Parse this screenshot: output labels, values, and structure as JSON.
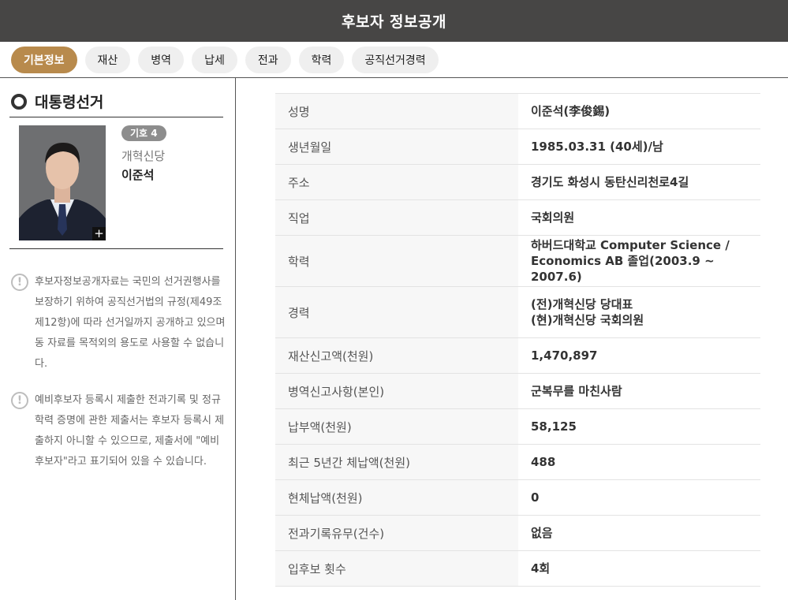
{
  "header": {
    "title": "후보자 정보공개"
  },
  "tabs": [
    {
      "label": "기본정보"
    },
    {
      "label": "재산"
    },
    {
      "label": "병역"
    },
    {
      "label": "납세"
    },
    {
      "label": "전과"
    },
    {
      "label": "학력"
    },
    {
      "label": "공직선거경력"
    }
  ],
  "sidebar": {
    "election_title": "대통령선거",
    "candidate": {
      "number_badge": "기호 4",
      "party": "개혁신당",
      "name": "이준석"
    },
    "notices": [
      "후보자정보공개자료는 국민의 선거권행사를 보장하기 위하여 공직선거법의 규정(제49조 제12항)에 따라 선거일까지 공개하고 있으며 동 자료를 목적외의 용도로 사용할 수 없습니다.",
      "예비후보자 등록시 제출한 전과기록 및 정규학력 증명에 관한 제출서는 후보자 등록시 제출하지 아니할 수 있으므로, 제출서에 \"예비후보자\"라고 표기되어 있을 수 있습니다."
    ]
  },
  "info_table": [
    {
      "label": "성명",
      "value": "이준석(李俊錫)"
    },
    {
      "label": "생년월일",
      "value": "1985.03.31 (40세)/남"
    },
    {
      "label": "주소",
      "value": "경기도 화성시 동탄신리천로4길"
    },
    {
      "label": "직업",
      "value": "국회의원"
    },
    {
      "label": "학력",
      "lines": [
        "하버드대학교 Computer Science /",
        "Economics AB 졸업(2003.9 ~ 2007.6)"
      ]
    },
    {
      "label": "경력",
      "lines": [
        "(전)개혁신당 당대표",
        "(현)개혁신당 국회의원"
      ]
    },
    {
      "label": "재산신고액(천원)",
      "value": "1,470,897"
    },
    {
      "label": "병역신고사항(본인)",
      "value": "군복무를 마친사람"
    },
    {
      "label": "납부액(천원)",
      "value": "58,125"
    },
    {
      "label": "최근 5년간 체납액(천원)",
      "value": "488"
    },
    {
      "label": "현체납액(천원)",
      "value": "0"
    },
    {
      "label": "전과기록유무(건수)",
      "value": "없음"
    },
    {
      "label": "입후보 횟수",
      "value": "4회"
    }
  ],
  "colors": {
    "header_bg": "#474645",
    "tab_active": "#b88a4c"
  },
  "icons": {
    "election_marker": "circle-icon",
    "photo_expand": "plus-icon",
    "notice": "exclamation-circle-icon"
  }
}
